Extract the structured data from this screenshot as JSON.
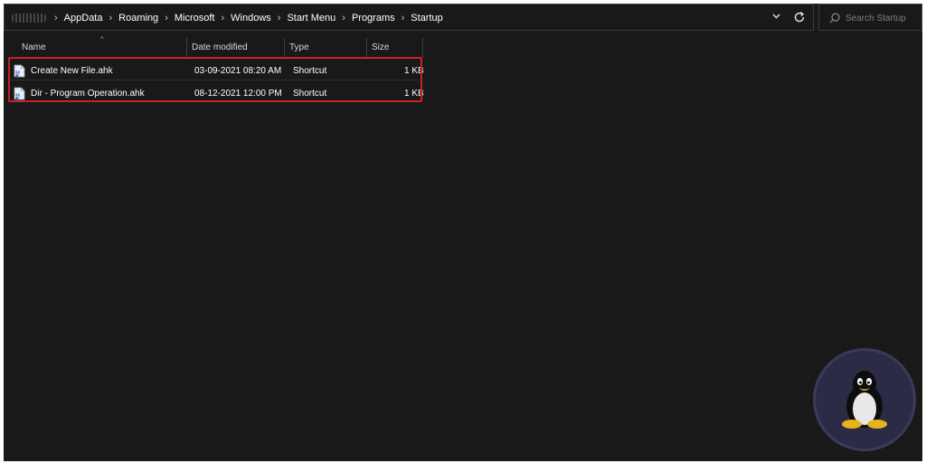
{
  "breadcrumb": {
    "items": [
      "AppData",
      "Roaming",
      "Microsoft",
      "Windows",
      "Start Menu",
      "Programs",
      "Startup"
    ],
    "separator": "›"
  },
  "search": {
    "placeholder": "Search Startup"
  },
  "columns": {
    "name": "Name",
    "date": "Date modified",
    "type": "Type",
    "size": "Size"
  },
  "files": [
    {
      "name": "Create New File.ahk",
      "date": "03-09-2021 08:20 AM",
      "type": "Shortcut",
      "size": "1 KB",
      "icon": "ahk-script-icon"
    },
    {
      "name": "Dir - Program Operation.ahk",
      "date": "08-12-2021 12:00 PM",
      "type": "Shortcut",
      "size": "1 KB",
      "icon": "ahk-script-icon"
    }
  ],
  "colors": {
    "background": "#191919",
    "highlight": "#cc1f2a",
    "text": "#ffffff"
  },
  "icons": {
    "dropdown": "chevron-down-icon",
    "refresh": "refresh-icon",
    "search": "search-icon",
    "watermark": "tux-penguin-logo"
  }
}
